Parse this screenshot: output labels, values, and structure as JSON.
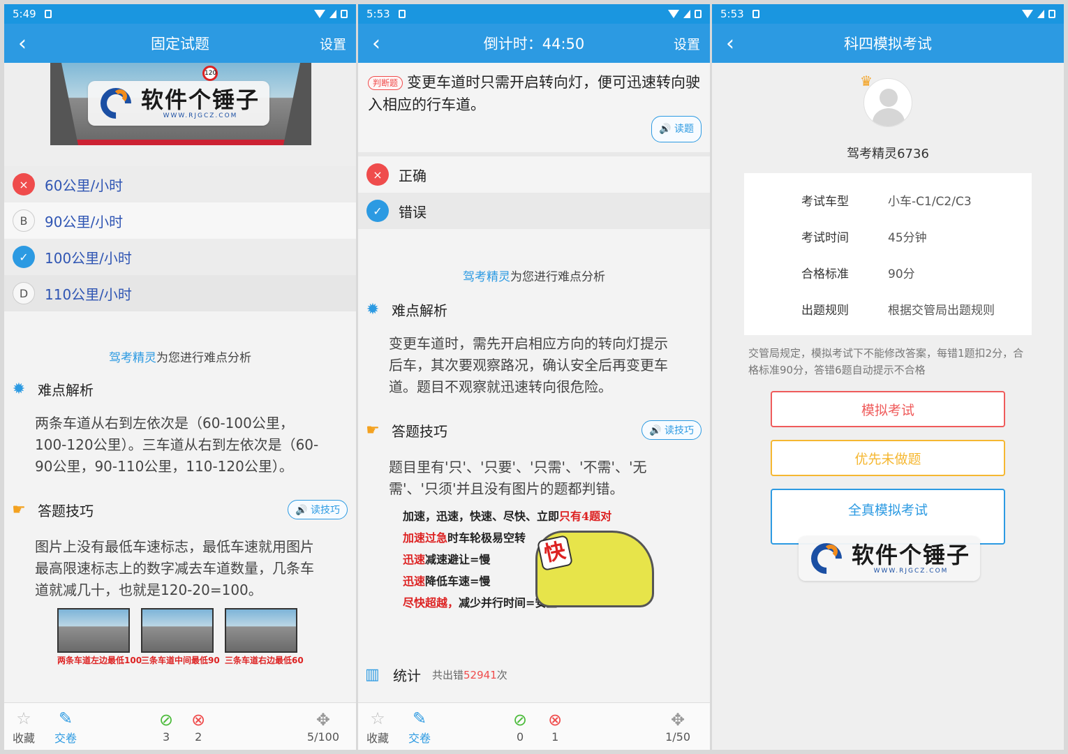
{
  "phone1": {
    "status": {
      "time": "5:49"
    },
    "appbar": {
      "back": "‹",
      "title": "固定试题",
      "settings": "设置"
    },
    "watermark": {
      "main": "软件个锤子",
      "sub": "WWW.RJGCZ.COM"
    },
    "sign_value": "120",
    "options": [
      {
        "badge": "×",
        "label": "60公里/小时"
      },
      {
        "badge": "B",
        "label": "90公里/小时"
      },
      {
        "badge": "✓",
        "label": "100公里/小时"
      },
      {
        "badge": "D",
        "label": "110公里/小时"
      }
    ],
    "analysis_brand": "驾考精灵",
    "analysis_rest": "为您进行难点分析",
    "difficulty_title": "难点解析",
    "difficulty_text": "两条车道从右到左依次是（60-100公里，100-120公里）。三车道从右到左依次是（60-90公里，90-110公里，110-120公里）。",
    "tips_title": "答题技巧",
    "tips_btn": "读技巧",
    "tips_text": "图片上没有最低车速标志，最低车速就用图片最高限速标志上的数字减去车道数量，几条车道就减几十，也就是120-20=100。",
    "thumb_captions": [
      "两条车道左边最低100",
      "三条车道中间最低90",
      "三条车道右边最低60"
    ],
    "bottom": {
      "fav": "收藏",
      "submit": "交卷",
      "right_count": "3",
      "wrong_count": "2",
      "progress": "5/100"
    }
  },
  "phone2": {
    "status": {
      "time": "5:53"
    },
    "appbar": {
      "back": "‹",
      "title": "倒计时：44:50",
      "settings": "设置"
    },
    "question_tag": "判断题",
    "question": "变更车道时只需开启转向灯，便可迅速转向驶入相应的行车道。",
    "read_btn": "读题",
    "options": [
      {
        "badge": "×",
        "label": "正确"
      },
      {
        "badge": "✓",
        "label": "错误"
      }
    ],
    "analysis_brand": "驾考精灵",
    "analysis_rest": "为您进行难点分析",
    "difficulty_title": "难点解析",
    "difficulty_text": "变更车道时，需先开启相应方向的转向灯提示后车，其次要观察路况，确认安全后再变更车道。题目不观察就迅速转向很危险。",
    "tips_title": "答题技巧",
    "tips_btn": "读技巧",
    "tips_text": "题目里有'只'、'只要'、'只需'、'不需'、'无需'、'只须'并且没有图片的题都判错。",
    "cartoon_lines": [
      {
        "a": "加速，迅速，快速、尽快、立即",
        "b": "只有4题对"
      },
      {
        "a": "加速过急",
        "b": "时车轮极易空转"
      },
      {
        "a": "迅速",
        "b": "减速避让=慢"
      },
      {
        "a": "迅速",
        "b": "降低车速=慢"
      },
      {
        "a": "尽快超越，",
        "b": "减少并行时间=安全"
      }
    ],
    "cartoon_badge": "快",
    "stats_title": "统计",
    "stats_prefix": "共出错",
    "stats_num": "52941",
    "stats_suffix": "次",
    "bottom": {
      "fav": "收藏",
      "submit": "交卷",
      "right_count": "0",
      "wrong_count": "1",
      "progress": "1/50"
    }
  },
  "phone3": {
    "status": {
      "time": "5:53"
    },
    "appbar": {
      "back": "‹",
      "title": "科四模拟考试"
    },
    "username": "驾考精灵6736",
    "info": [
      {
        "k": "考试车型",
        "v": "小车-C1/C2/C3"
      },
      {
        "k": "考试时间",
        "v": "45分钟"
      },
      {
        "k": "合格标准",
        "v": "90分"
      },
      {
        "k": "出题规则",
        "v": "根据交管局出题规则"
      }
    ],
    "notice": "交管局规定，模拟考试下不能修改答案，每错1题扣2分，合格标准90分，答错6题自动提示不合格",
    "btn_mock": "模拟考试",
    "btn_priority": "优先未做题",
    "btn_full": "全真模拟考试",
    "watermark": {
      "main": "软件个锤子",
      "sub": "WWW.RJGCZ.COM"
    }
  },
  "colors": {
    "primary": "#2c9ae2",
    "error": "#ef4c4c",
    "orange": "#f5b731",
    "success": "#4cbb3b"
  }
}
